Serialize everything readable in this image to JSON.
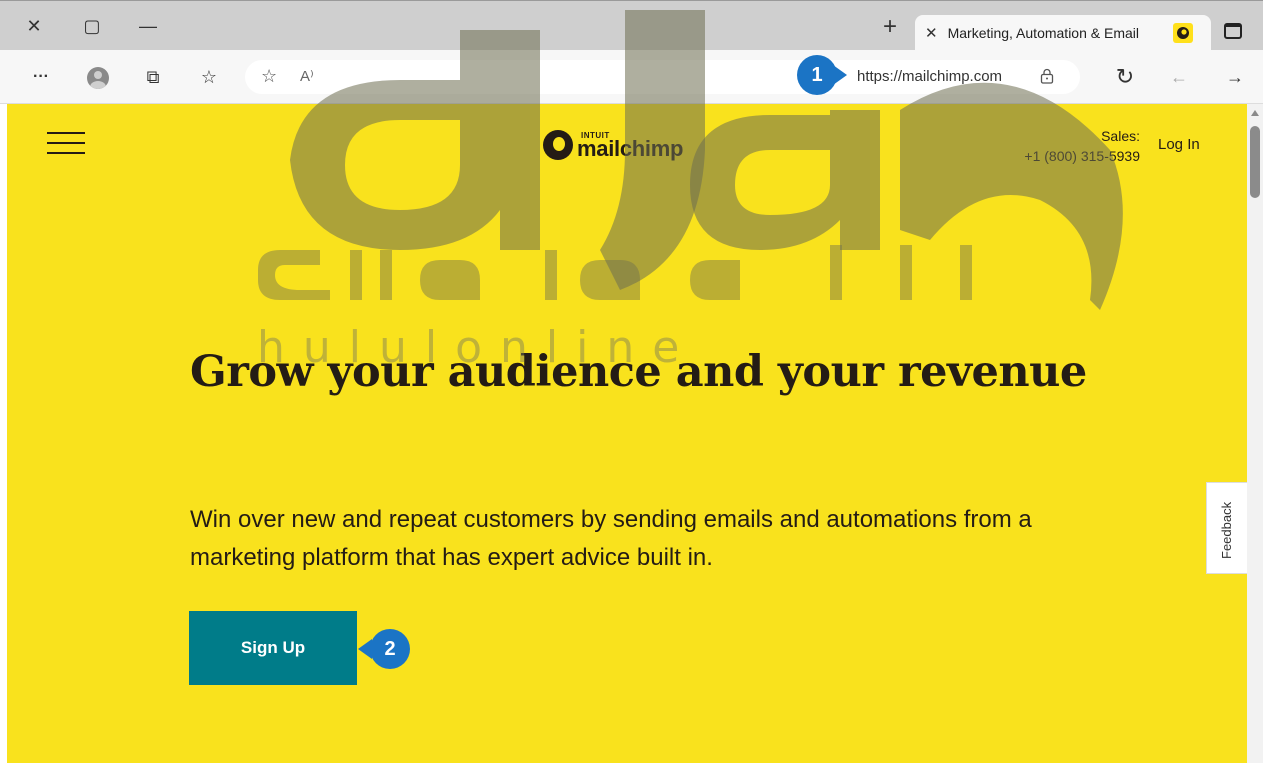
{
  "window": {
    "close_glyph": "✕",
    "maximize_glyph": "▢",
    "minimize_glyph": "—",
    "new_tab_glyph": "+"
  },
  "tab": {
    "close_glyph": "✕",
    "title": "Marketing, Automation & Email"
  },
  "toolbar": {
    "menu_glyph": "···",
    "collections_glyph": "⧉",
    "favorites_glyph": "☆",
    "add_favorite_glyph": "☆",
    "read_aloud_glyph": "A⁾",
    "refresh_glyph": "↻",
    "back_glyph": "←",
    "forward_glyph": "→",
    "url": "https://mailchimp.com"
  },
  "site": {
    "logo_small": "INTUIT",
    "logo_word": "mailchimp",
    "sales_label": "Sales:",
    "sales_phone": "+1 (800) 315-5939",
    "login": "Log In",
    "headline": "Grow your audience and your revenue",
    "subtext": "Win over new and repeat customers by sending emails and automations from a marketing platform that has expert advice built in.",
    "signup": "Sign Up",
    "feedback": "Feedback"
  },
  "callouts": {
    "one": "1",
    "two": "2"
  },
  "watermark": {
    "arabic": "الحلول اون لاين",
    "latin": "hululonline"
  },
  "colors": {
    "page_bg": "#f9e21d",
    "signup_bg": "#007c89",
    "callout": "#1b74c5"
  }
}
